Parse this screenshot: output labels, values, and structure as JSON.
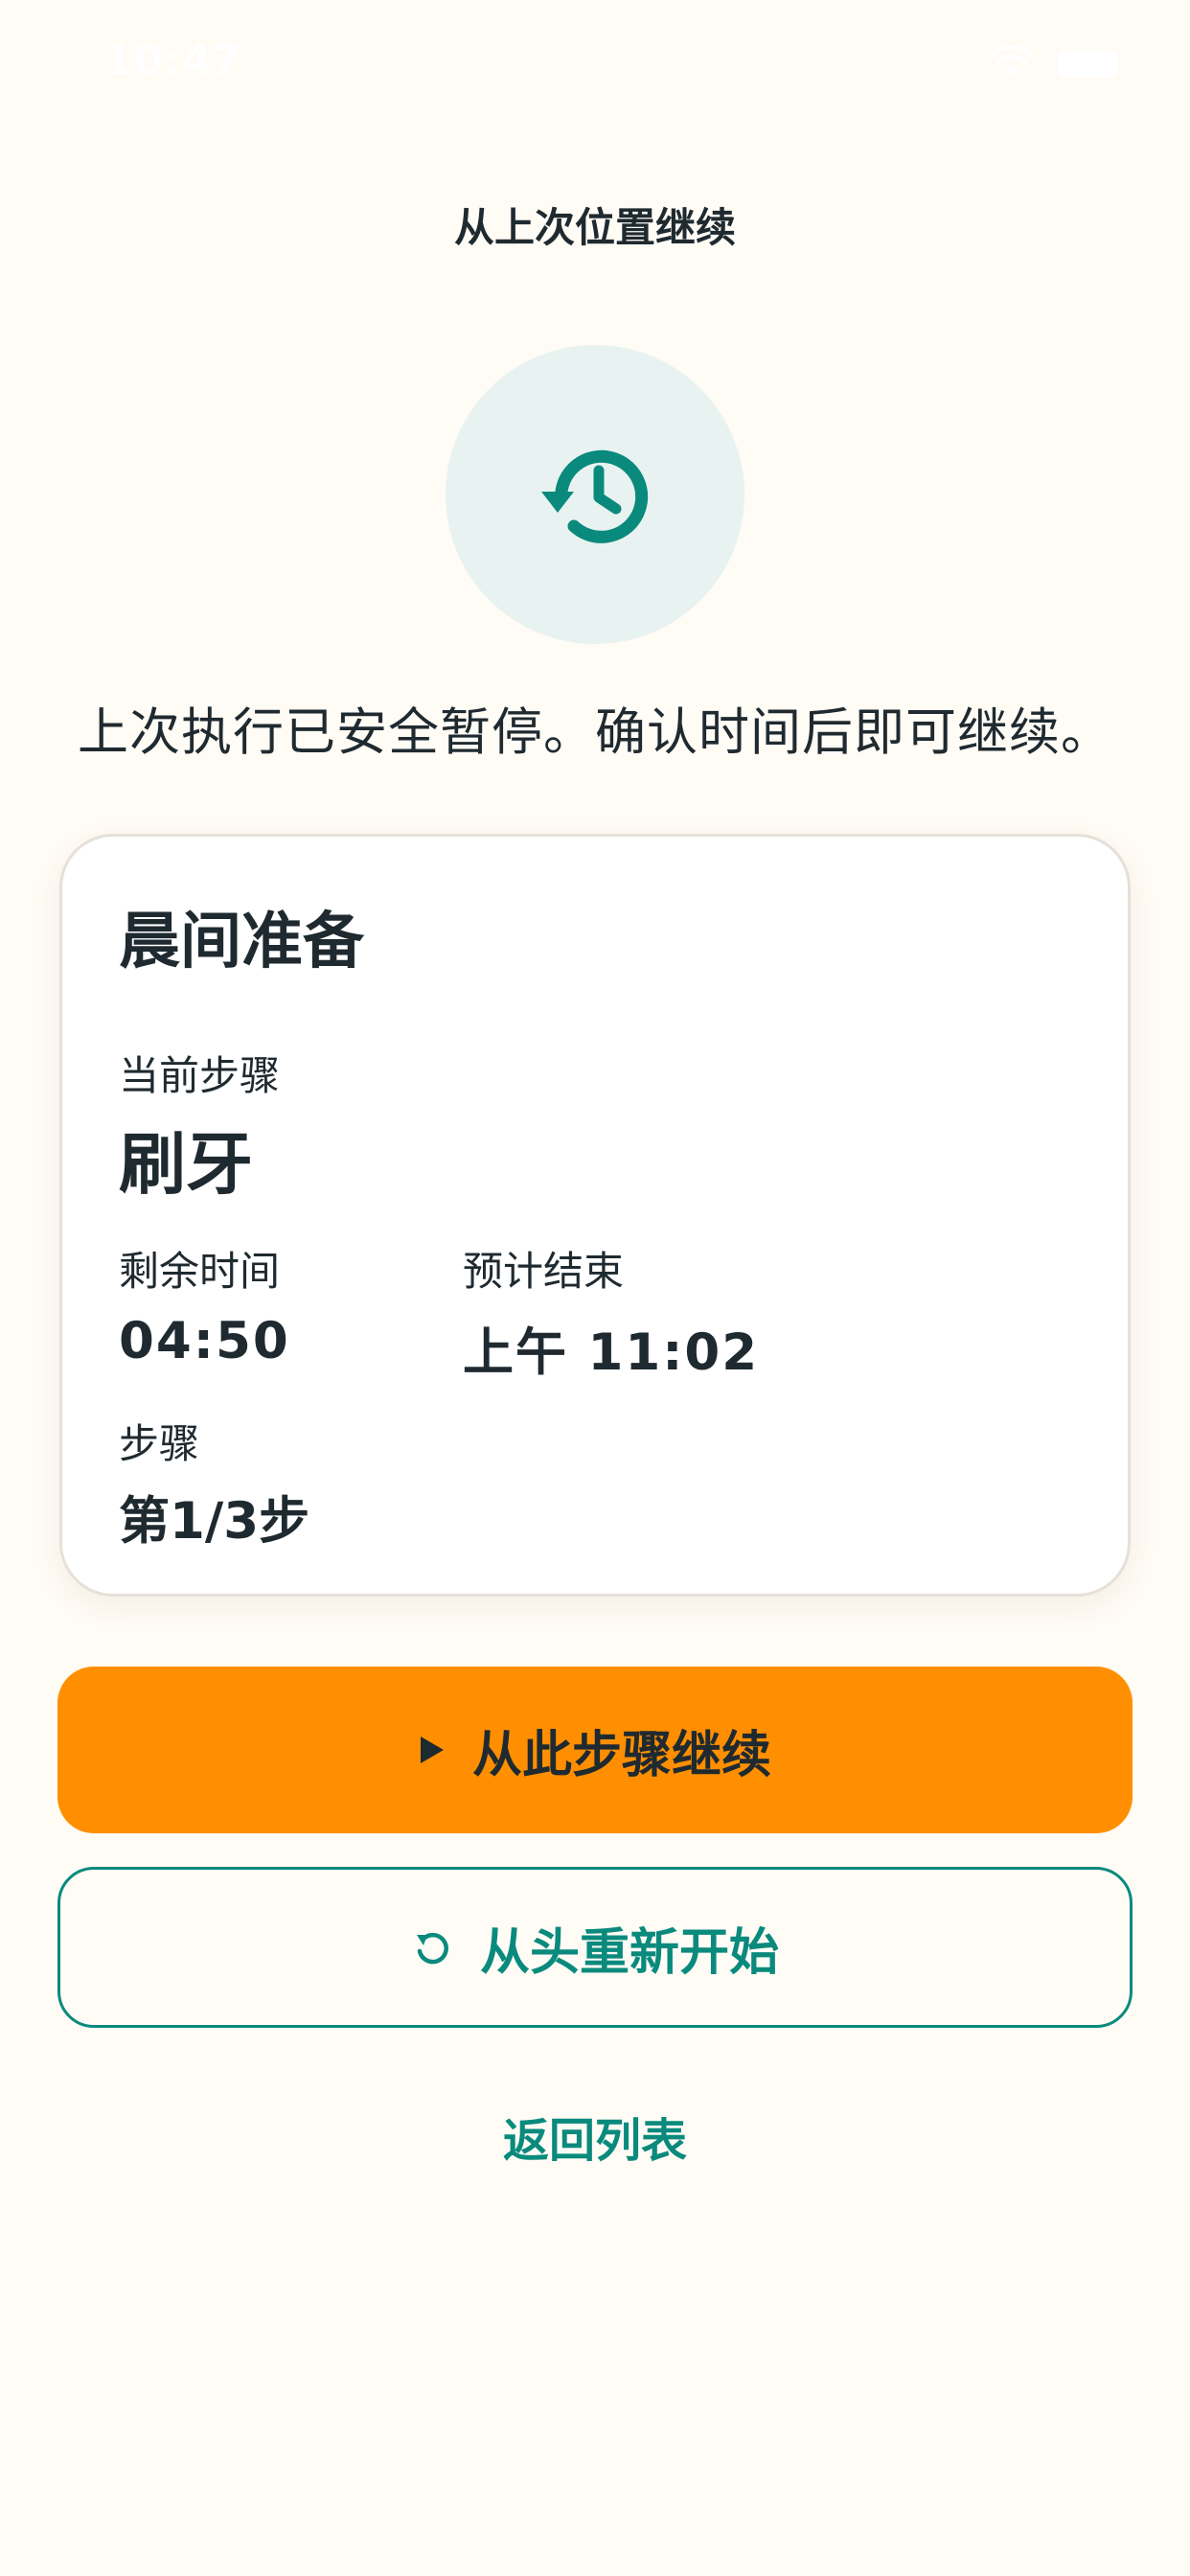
{
  "status_bar": {
    "time": "10:47",
    "icons": [
      "wifi-icon",
      "battery-icon"
    ]
  },
  "nav": {
    "title": "从上次位置继续"
  },
  "hero": {
    "icon": "history-icon",
    "message": "上次执行已安全暂停。确认时间后即可继续。"
  },
  "card": {
    "routine_name": "晨间准备",
    "current_step_label": "当前步骤",
    "current_step_value": "刷牙",
    "remaining_label": "剩余时间",
    "remaining_value": "04:50",
    "end_label": "预计结束",
    "end_value": "上午 11:02",
    "step_label": "步骤",
    "step_value": "第1/3步"
  },
  "actions": {
    "resume_label": "从此步骤继续",
    "resume_icon": "play-icon",
    "restart_label": "从头重新开始",
    "restart_icon": "restart-icon",
    "back_label": "返回列表"
  },
  "colors": {
    "background": "#FFFBF5",
    "accent_orange": "#FF8F00",
    "accent_teal": "#0A8A7D",
    "icon_circle": "#E8F3F1",
    "text": "#1F2A30"
  }
}
